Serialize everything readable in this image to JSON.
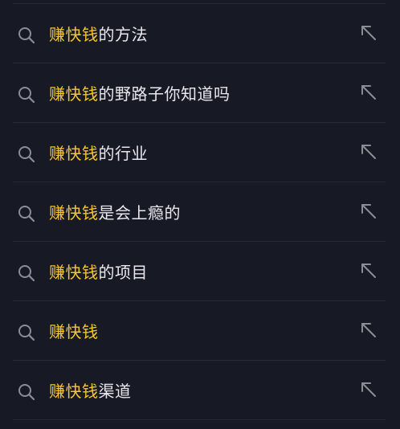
{
  "suggestions": [
    {
      "highlight": "赚快钱",
      "rest": "的方法",
      "icon": "search-icon",
      "action_icon": "arrow-up-left-icon"
    },
    {
      "highlight": "赚快钱",
      "rest": "的野路子你知道吗",
      "icon": "search-icon",
      "action_icon": "arrow-up-left-icon"
    },
    {
      "highlight": "赚快钱",
      "rest": "的行业",
      "icon": "search-icon",
      "action_icon": "arrow-up-left-icon"
    },
    {
      "highlight": "赚快钱",
      "rest": "是会上瘾的",
      "icon": "search-icon",
      "action_icon": "arrow-up-left-icon"
    },
    {
      "highlight": "赚快钱",
      "rest": "的项目",
      "icon": "search-icon",
      "action_icon": "arrow-up-left-icon"
    },
    {
      "highlight": "赚快钱",
      "rest": "",
      "icon": "search-icon",
      "action_icon": "arrow-up-left-icon"
    },
    {
      "highlight": "赚快钱",
      "rest": "渠道",
      "icon": "search-icon",
      "action_icon": "arrow-up-left-icon"
    }
  ],
  "colors": {
    "background": "#171a24",
    "highlight": "#f7c72f",
    "text": "#e8e9ee",
    "icon": "#8a8d96",
    "divider": "#262a35"
  }
}
